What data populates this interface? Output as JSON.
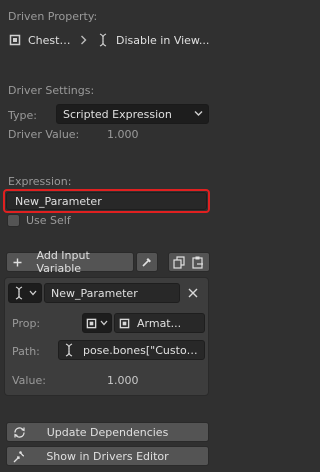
{
  "driven_property": {
    "heading": "Driven Property:",
    "object_name": "ChestF...",
    "path": "Disable in View..."
  },
  "driver_settings": {
    "heading": "Driver Settings:",
    "type_label": "Type:",
    "type_value": "Scripted Expression",
    "value_label": "Driver Value:",
    "value": "1.000"
  },
  "expression": {
    "heading": "Expression:",
    "value": "New_Parameter",
    "highlight_color": "#e02020"
  },
  "use_self": {
    "label": "Use Self",
    "checked": false
  },
  "add_variable": {
    "label": "Add Input Variable"
  },
  "variable": {
    "name": "New_Parameter",
    "prop_label": "Prop:",
    "prop_id": "Armat...",
    "path_label": "Path:",
    "path_value": "pose.bones[\"Customi...",
    "value_label": "Value:",
    "value": "1.000"
  },
  "buttons": {
    "update": "Update Dependencies",
    "show_editor": "Show in Drivers Editor"
  }
}
